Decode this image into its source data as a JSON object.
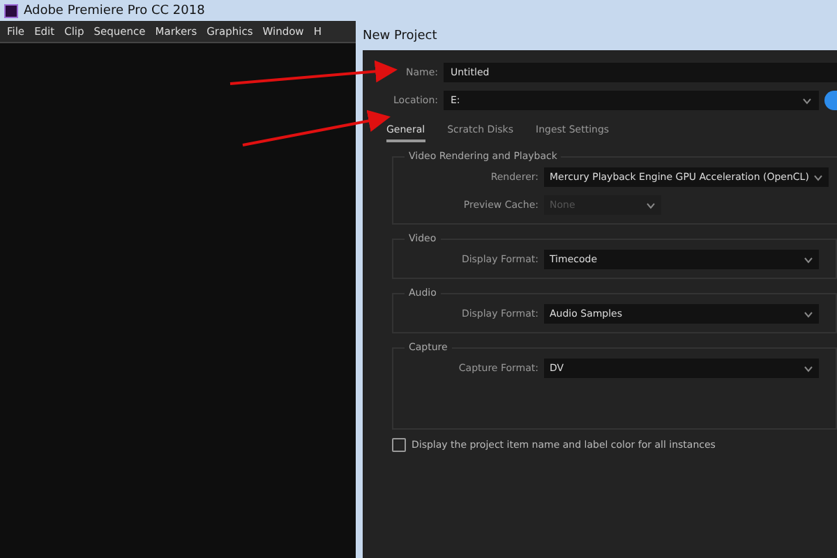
{
  "app_window": {
    "title": "Adobe Premiere Pro CC 2018",
    "menu": [
      "File",
      "Edit",
      "Clip",
      "Sequence",
      "Markers",
      "Graphics",
      "Window",
      "H"
    ]
  },
  "dialog": {
    "title": "New Project",
    "name_label": "Name:",
    "name_value": "Untitled",
    "location_label": "Location:",
    "location_value": "E:",
    "tabs": [
      {
        "label": "General",
        "selected": true
      },
      {
        "label": "Scratch Disks",
        "selected": false
      },
      {
        "label": "Ingest Settings",
        "selected": false
      }
    ],
    "sections": [
      {
        "title": "Video Rendering and Playback",
        "fields": [
          {
            "label": "Renderer:",
            "value": "Mercury Playback Engine GPU Acceleration (OpenCL)",
            "disabled": false
          },
          {
            "label": "Preview Cache:",
            "value": "None",
            "disabled": true
          }
        ]
      },
      {
        "title": "Video",
        "fields": [
          {
            "label": "Display Format:",
            "value": "Timecode",
            "disabled": false
          }
        ]
      },
      {
        "title": "Audio",
        "fields": [
          {
            "label": "Display Format:",
            "value": "Audio Samples",
            "disabled": false
          }
        ]
      },
      {
        "title": "Capture",
        "fields": [
          {
            "label": "Capture Format:",
            "value": "DV",
            "disabled": false
          }
        ]
      }
    ],
    "checkbox": {
      "label": "Display the project item name and label color for all instances",
      "checked": false
    }
  }
}
